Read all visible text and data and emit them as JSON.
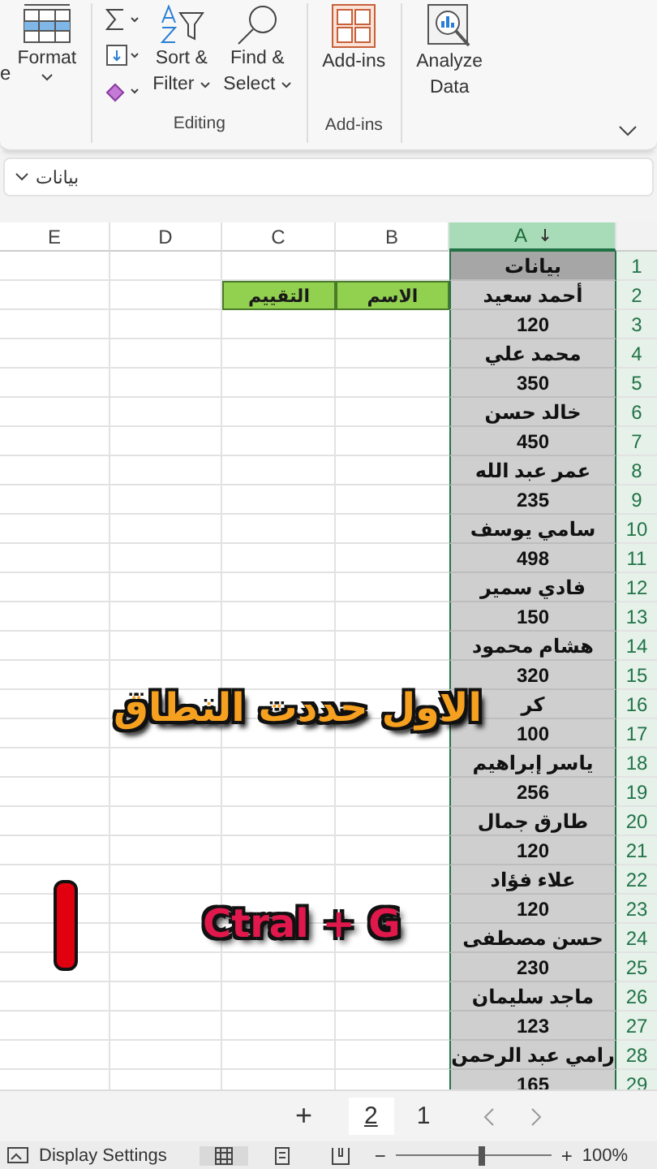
{
  "ribbon": {
    "cut_text": "e",
    "format": "Format",
    "sort_filter": [
      "Sort &",
      "Filter"
    ],
    "find_select": [
      "Find &",
      "Select"
    ],
    "editing_label": "Editing",
    "addins_button": "Add-ins",
    "addins_label": "Add-ins",
    "analyze": [
      "Analyze",
      "Data"
    ]
  },
  "name_box": "بيانات",
  "columns": [
    {
      "label": "A",
      "selected": true
    },
    {
      "label": "B",
      "selected": false
    },
    {
      "label": "C",
      "selected": false
    },
    {
      "label": "D",
      "selected": false
    },
    {
      "label": "E",
      "selected": false
    }
  ],
  "rows": [
    {
      "number": "1",
      "kind": "title",
      "a": "بيانات"
    },
    {
      "number": "2",
      "kind": "plain",
      "a": "أحمد سعيد",
      "b": "الاسم",
      "c": "التقييم",
      "highlighted": true
    },
    {
      "number": "3",
      "kind": "plain",
      "a": "120"
    },
    {
      "number": "4",
      "kind": "plain",
      "a": "محمد علي"
    },
    {
      "number": "5",
      "kind": "plain",
      "a": "350"
    },
    {
      "number": "6",
      "kind": "plain",
      "a": "خالد حسن"
    },
    {
      "number": "7",
      "kind": "plain",
      "a": "450"
    },
    {
      "number": "8",
      "kind": "plain",
      "a": "عمر عبد الله"
    },
    {
      "number": "9",
      "kind": "plain",
      "a": "235"
    },
    {
      "number": "10",
      "kind": "plain",
      "a": "سامي يوسف"
    },
    {
      "number": "11",
      "kind": "plain",
      "a": "498"
    },
    {
      "number": "12",
      "kind": "plain",
      "a": "فادي سمير"
    },
    {
      "number": "13",
      "kind": "plain",
      "a": "150"
    },
    {
      "number": "14",
      "kind": "plain",
      "a": "هشام محمود"
    },
    {
      "number": "15",
      "kind": "plain",
      "a": "320"
    },
    {
      "number": "16",
      "kind": "plain",
      "a": "كر"
    },
    {
      "number": "17",
      "kind": "plain",
      "a": "100"
    },
    {
      "number": "18",
      "kind": "plain",
      "a": "ياسر إبراهيم"
    },
    {
      "number": "19",
      "kind": "plain",
      "a": "256"
    },
    {
      "number": "20",
      "kind": "plain",
      "a": "طارق جمال"
    },
    {
      "number": "21",
      "kind": "plain",
      "a": "120"
    },
    {
      "number": "22",
      "kind": "plain",
      "a": "علاء فؤاد"
    },
    {
      "number": "23",
      "kind": "plain",
      "a": "120"
    },
    {
      "number": "24",
      "kind": "plain",
      "a": "حسن مصطفى"
    },
    {
      "number": "25",
      "kind": "plain",
      "a": "230"
    },
    {
      "number": "26",
      "kind": "plain",
      "a": "ماجد سليمان"
    },
    {
      "number": "27",
      "kind": "plain",
      "a": "123"
    },
    {
      "number": "28",
      "kind": "plain",
      "a": "رامي عبد الرحمن"
    },
    {
      "number": "29",
      "kind": "plain",
      "a": "165"
    }
  ],
  "sheet_tabs": {
    "add": "+",
    "tabs": [
      {
        "label": "1",
        "selected": false
      },
      {
        "label": "2",
        "selected": true
      }
    ]
  },
  "status_bar": {
    "display_settings": "Display Settings",
    "zoom_minus": "−",
    "zoom_plus": "+",
    "zoom": {
      "level": 0.55
    },
    "zoom_reading": "100%"
  },
  "captions": [
    {
      "kind": "headline",
      "text": "الاول حددت النطاق"
    },
    {
      "kind": "shortcut",
      "text": "Ctral + G"
    }
  ]
}
